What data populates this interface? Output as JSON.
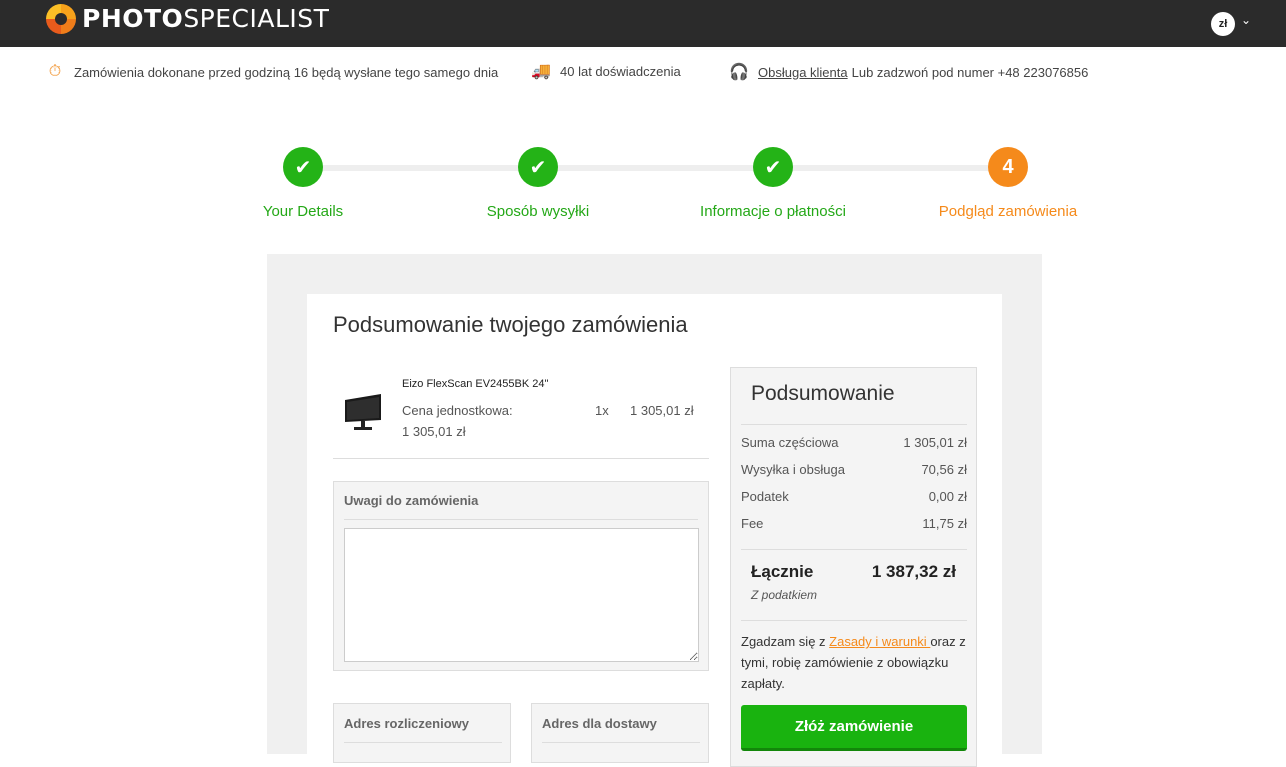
{
  "header": {
    "logo_bold": "PHOTO",
    "logo_regular": "SPECIALIST",
    "currency": "zł"
  },
  "usp": {
    "shipping": "Zamówienia dokonane przed godziną 16 będą wysłane tego samego dnia",
    "experience": "40 lat doświadczenia",
    "support_link": "Obsługa klienta",
    "support_text": "Lub zadzwoń pod numer +48 223076856"
  },
  "steps": [
    {
      "label": "Your Details",
      "status": "done"
    },
    {
      "label": "Sposób wysyłki",
      "status": "done"
    },
    {
      "label": "Informacje o płatności",
      "status": "done"
    },
    {
      "label": "Podgląd zamówienia",
      "status": "active",
      "number": "4"
    }
  ],
  "order": {
    "title": "Podsumowanie twojego zamówienia",
    "product": {
      "name": "Eizo FlexScan EV2455BK 24\"",
      "unit_price_label": "Cena jednostkowa:",
      "unit_price": "1 305,01 zł",
      "qty": "1x",
      "line_total": "1 305,01 zł"
    },
    "notes_title": "Uwagi do zamówienia",
    "billing_title": "Adres rozliczeniowy",
    "shipping_title": "Adres dla dostawy"
  },
  "summary": {
    "title": "Podsumowanie",
    "rows": [
      {
        "label": "Suma częściowa",
        "value": "1 305,01 zł"
      },
      {
        "label": "Wysyłka i obsługa",
        "value": "70,56 zł"
      },
      {
        "label": "Podatek",
        "value": "0,00 zł"
      },
      {
        "label": "Fee",
        "value": "11,75 zł"
      }
    ],
    "total_label": "Łącznie",
    "total_value": "1 387,32 zł",
    "total_sub": "Z podatkiem",
    "terms_prefix": "Zgadzam się z ",
    "terms_link": "Zasady i warunki ",
    "terms_suffix": "oraz z tymi, robię zamówienie z obowiązku zapłaty.",
    "button": "Złóż zamówienie"
  },
  "colors": {
    "done": "#24b317",
    "active": "#f58a1b",
    "button": "#19b30f"
  }
}
